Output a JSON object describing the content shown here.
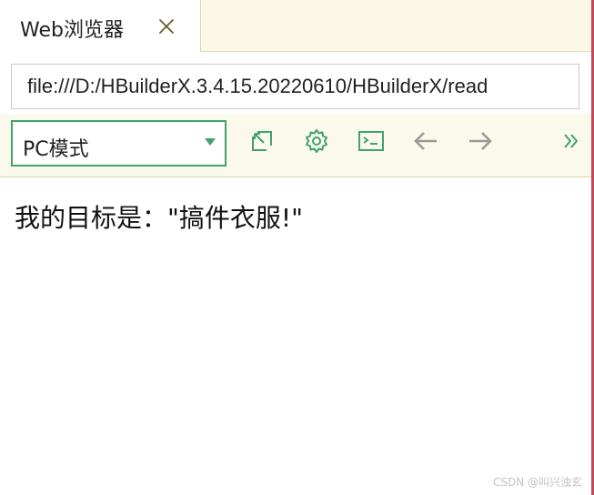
{
  "tab": {
    "title": "Web浏览器",
    "close_icon": "close-icon"
  },
  "address_bar": {
    "value": "file:///D:/HBuilderX.3.4.15.20220610/HBuilderX/read"
  },
  "toolbar": {
    "mode_select": {
      "selected": "PC模式"
    },
    "buttons": [
      {
        "name": "open-external-icon"
      },
      {
        "name": "settings-icon"
      },
      {
        "name": "console-icon"
      },
      {
        "name": "back-icon"
      },
      {
        "name": "forward-icon"
      },
      {
        "name": "more-icon"
      }
    ]
  },
  "page": {
    "text": "我的目标是：\"搞件衣服!\""
  },
  "watermark": {
    "text": "CSDN @叫兴浊玄"
  },
  "colors": {
    "accent": "#3ea46b",
    "disabled": "#9a9a9a",
    "chrome_bg": "#fbf8ec",
    "window_edge": "#c04a5a"
  }
}
